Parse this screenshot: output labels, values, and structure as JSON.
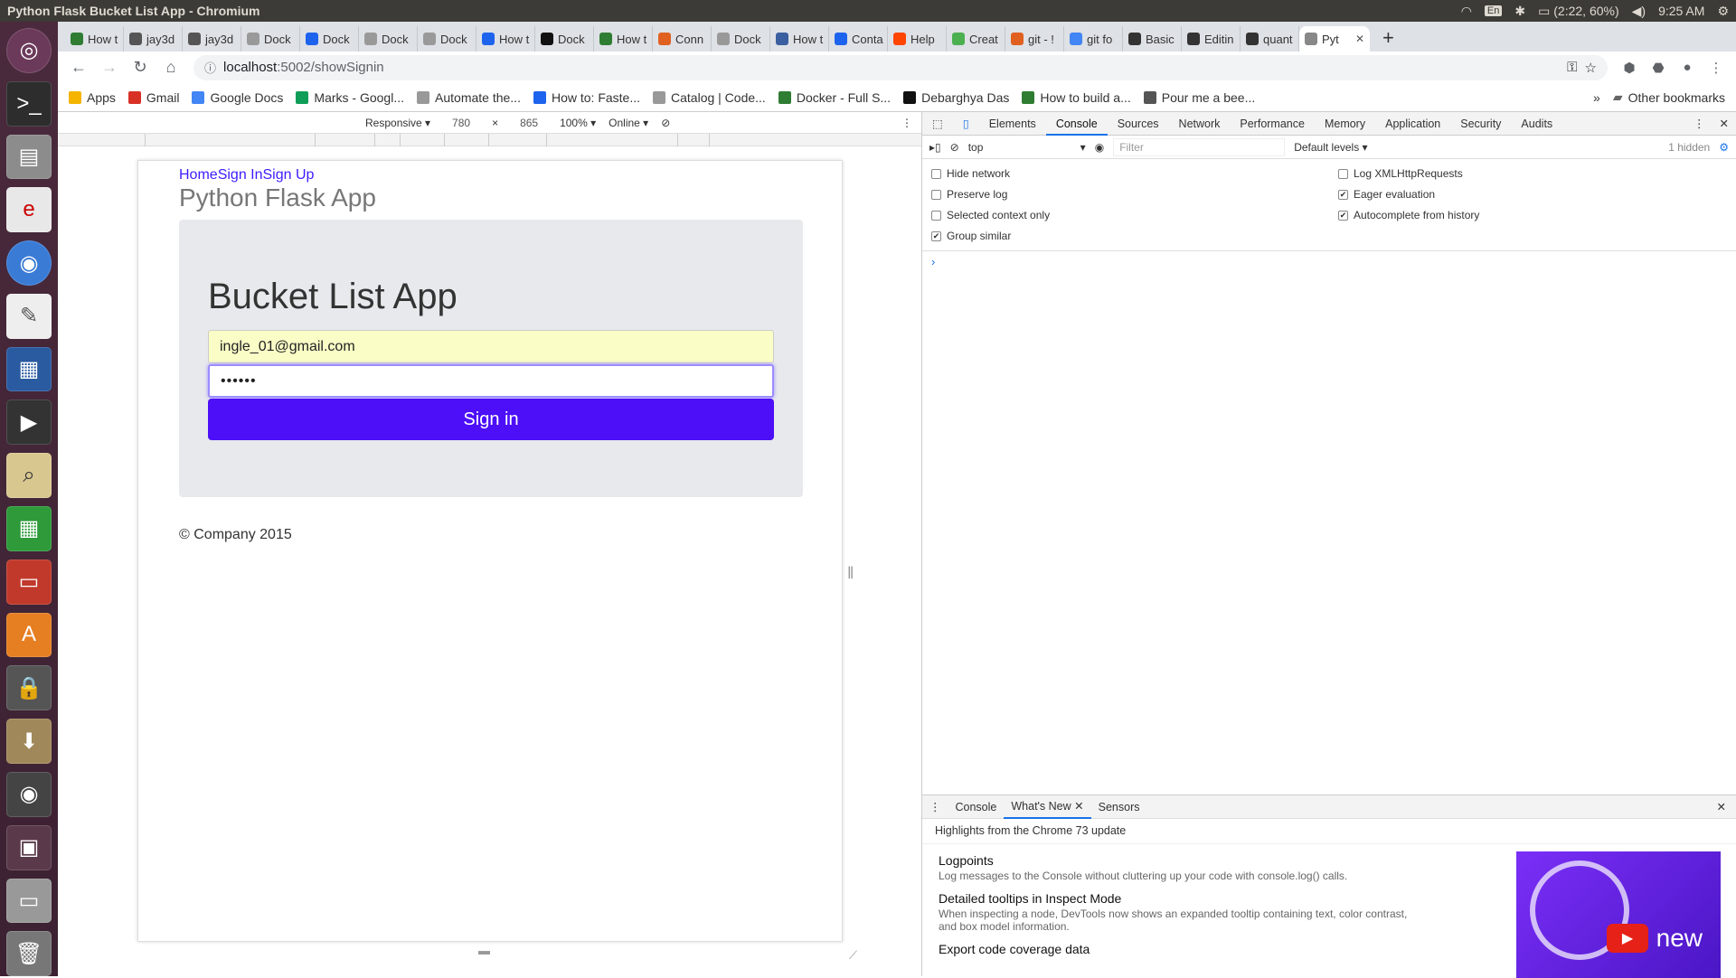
{
  "window": {
    "title": "Python Flask Bucket List App - Chromium"
  },
  "tray": {
    "lang": "En",
    "battery": "(2:22, 60%)",
    "clock": "9:25 AM"
  },
  "tabs": [
    {
      "label": "How t",
      "color": "#2e7d32"
    },
    {
      "label": "jay3d",
      "color": "#555"
    },
    {
      "label": "jay3d",
      "color": "#555"
    },
    {
      "label": "Dock",
      "color": "#999"
    },
    {
      "label": "Dock",
      "color": "#1d63ed"
    },
    {
      "label": "Dock",
      "color": "#999"
    },
    {
      "label": "Dock",
      "color": "#999"
    },
    {
      "label": "How t",
      "color": "#1d63ed"
    },
    {
      "label": "Dock",
      "color": "#111"
    },
    {
      "label": "How t",
      "color": "#2e7d32"
    },
    {
      "label": "Conn",
      "color": "#e06020"
    },
    {
      "label": "Dock",
      "color": "#999"
    },
    {
      "label": "How t",
      "color": "#3a5fa0"
    },
    {
      "label": "Conta",
      "color": "#1d63ed"
    },
    {
      "label": "Help",
      "color": "#ff4500"
    },
    {
      "label": "Creat",
      "color": "#4caf50"
    },
    {
      "label": "git - !",
      "color": "#e06020"
    },
    {
      "label": "git fo",
      "color": "#4285f4"
    },
    {
      "label": "Basic",
      "color": "#333"
    },
    {
      "label": "Editin",
      "color": "#333"
    },
    {
      "label": "quant",
      "color": "#333"
    },
    {
      "label": "Pyt",
      "color": "#888",
      "active": true
    }
  ],
  "address": {
    "host": "localhost",
    "path": ":5002/showSignin"
  },
  "bookmarks": [
    {
      "label": "Apps",
      "color": "#f4b400"
    },
    {
      "label": "Gmail",
      "color": "#d93025"
    },
    {
      "label": "Google Docs",
      "color": "#4285f4"
    },
    {
      "label": "Marks - Googl...",
      "color": "#0f9d58"
    },
    {
      "label": "Automate the...",
      "color": "#999"
    },
    {
      "label": "How to: Faste...",
      "color": "#1d63ed"
    },
    {
      "label": "Catalog | Code...",
      "color": "#999"
    },
    {
      "label": "Docker - Full S...",
      "color": "#2e7d32"
    },
    {
      "label": "Debarghya Das",
      "color": "#111"
    },
    {
      "label": "How to build a...",
      "color": "#2e7d32"
    },
    {
      "label": "Pour me a bee...",
      "color": "#555"
    }
  ],
  "bookmarks_other": "Other bookmarks",
  "device": {
    "mode": "Responsive",
    "width": "780",
    "height": "865",
    "zoom": "100%",
    "network": "Online"
  },
  "site": {
    "nav": [
      "Home",
      "Sign In",
      "Sign Up"
    ],
    "brand": "Python Flask App",
    "heading": "Bucket List App",
    "email": "ingle_01@gmail.com",
    "password_mask": "••••••",
    "signin": "Sign in",
    "footer": "© Company 2015"
  },
  "devtools": {
    "tabs": [
      "Elements",
      "Console",
      "Sources",
      "Network",
      "Performance",
      "Memory",
      "Application",
      "Security",
      "Audits"
    ],
    "active_tab": "Console",
    "context": "top",
    "filter_placeholder": "Filter",
    "levels": "Default levels ▾",
    "hidden": "1 hidden",
    "options": [
      {
        "label": "Hide network",
        "checked": false
      },
      {
        "label": "Log XMLHttpRequests",
        "checked": false
      },
      {
        "label": "Preserve log",
        "checked": false
      },
      {
        "label": "Eager evaluation",
        "checked": true
      },
      {
        "label": "Selected context only",
        "checked": false
      },
      {
        "label": "Autocomplete from history",
        "checked": true
      },
      {
        "label": "Group similar",
        "checked": true
      }
    ],
    "drawer": {
      "tabs": [
        "Console",
        "What's New",
        "Sensors"
      ],
      "highlight": "Highlights from the Chrome 73 update",
      "features": [
        {
          "title": "Logpoints",
          "desc": "Log messages to the Console without cluttering up your code with console.log() calls."
        },
        {
          "title": "Detailed tooltips in Inspect Mode",
          "desc": "When inspecting a node, DevTools now shows an expanded tooltip containing text, color contrast, and box model information."
        },
        {
          "title": "Export code coverage data",
          "desc": ""
        }
      ],
      "promo_text": "new"
    }
  }
}
